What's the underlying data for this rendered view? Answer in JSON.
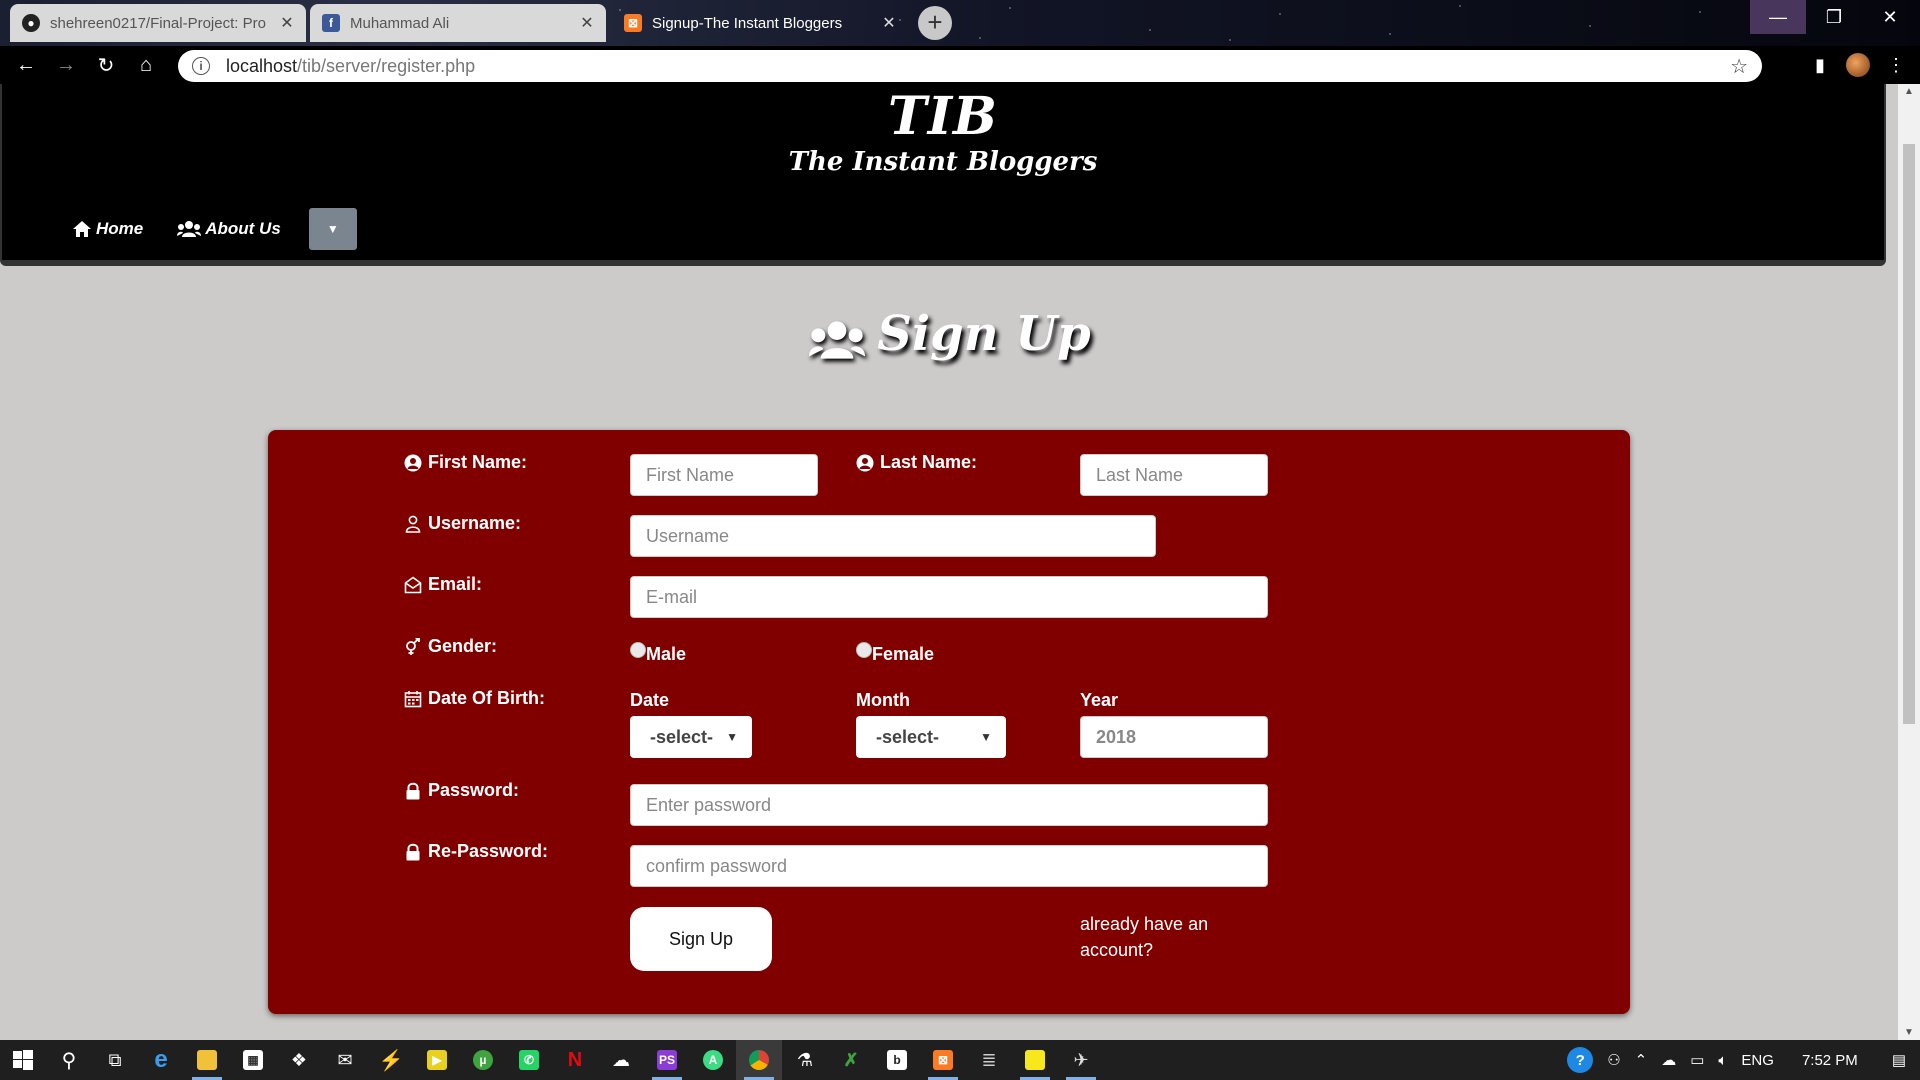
{
  "browser": {
    "tabs": [
      {
        "title": "shehreen0217/Final-Project: Pro",
        "icon": "github-icon",
        "active": false
      },
      {
        "title": "Muhammad Ali",
        "icon": "facebook-icon",
        "active": false
      },
      {
        "title": "Signup-The Instant Bloggers",
        "icon": "xampp-icon",
        "active": true
      }
    ],
    "url_host": "localhost",
    "url_path": "/tib/server/register.php"
  },
  "site": {
    "logo_title": "TIB",
    "logo_subtitle": "The Instant Bloggers",
    "nav": {
      "home": "Home",
      "about": "About Us"
    }
  },
  "page": {
    "title": "Sign Up"
  },
  "form": {
    "first_name_label": "First Name:",
    "first_name_placeholder": "First Name",
    "last_name_label": "Last Name:",
    "last_name_placeholder": "Last Name",
    "username_label": "Username:",
    "username_placeholder": "Username",
    "email_label": "Email:",
    "email_placeholder": "E-mail",
    "gender_label": "Gender:",
    "gender_male": "Male",
    "gender_female": "Female",
    "dob_label": "Date Of Birth:",
    "date_label": "Date",
    "month_label": "Month",
    "year_label": "Year",
    "date_selected": "-select-",
    "month_selected": "-select-",
    "year_value": "2018",
    "password_label": "Password:",
    "password_placeholder": "Enter password",
    "repassword_label": "Re-Password:",
    "repassword_placeholder": "confirm password",
    "submit_label": "Sign Up",
    "login_prompt": "already have an account?"
  },
  "taskbar": {
    "language": "ENG",
    "time": "7:52 PM"
  },
  "colors": {
    "form_background": "#800000",
    "page_background": "#cdcaca",
    "header_background": "#000000"
  }
}
